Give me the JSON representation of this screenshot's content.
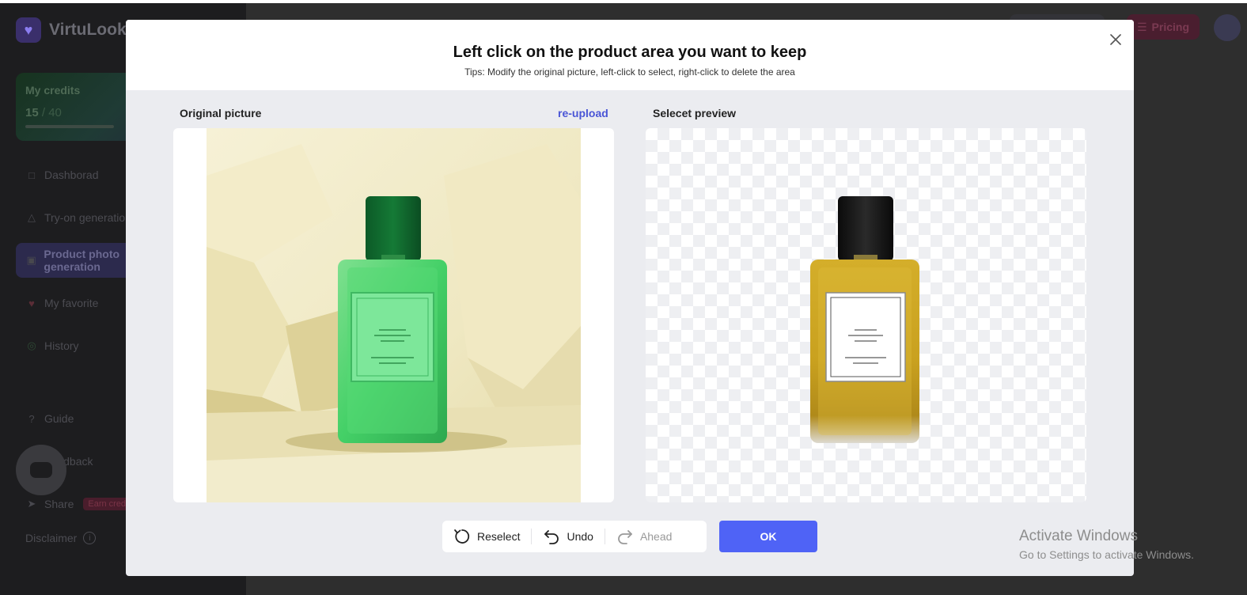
{
  "app": {
    "brand": "VirtuLook",
    "credits": {
      "title": "My credits",
      "used": "15",
      "separator": " / ",
      "total": "40",
      "progress": 0.375
    },
    "nav": [
      {
        "label": "Dashborad",
        "icon": "dashboard-icon"
      },
      {
        "label": "Try-on generation",
        "icon": "shirt-icon"
      },
      {
        "label": "Product photo generation",
        "icon": "edit-image-icon",
        "active": true
      },
      {
        "label": "My favorite",
        "icon": "heart-icon"
      },
      {
        "label": "History",
        "icon": "history-icon"
      }
    ],
    "guide": "Guide",
    "feedback": "Feedback",
    "share": "Share",
    "share_badge": "Earn credits",
    "disclaimer": "Disclaimer",
    "pricing": "Pricing"
  },
  "dialog": {
    "title": "Left click on the product area you want to keep",
    "tips": "Tips: Modify the original picture, left-click to select, right-click to delete the area",
    "close_icon": "close-icon",
    "left_label": "Original picture",
    "reupload": "re-upload",
    "right_label": "Selecet preview",
    "toolbar": {
      "reselect": "Reselect",
      "undo": "Undo",
      "ahead": "Ahead"
    },
    "ok": "OK"
  },
  "watermark": {
    "title": "Activate Windows",
    "subtitle": "Go to Settings to activate Windows."
  },
  "colors": {
    "accent": "#4f63f6",
    "link": "#4a55d6",
    "perfume_green": "#44d067",
    "perfume_amber": "#c9a11f"
  }
}
